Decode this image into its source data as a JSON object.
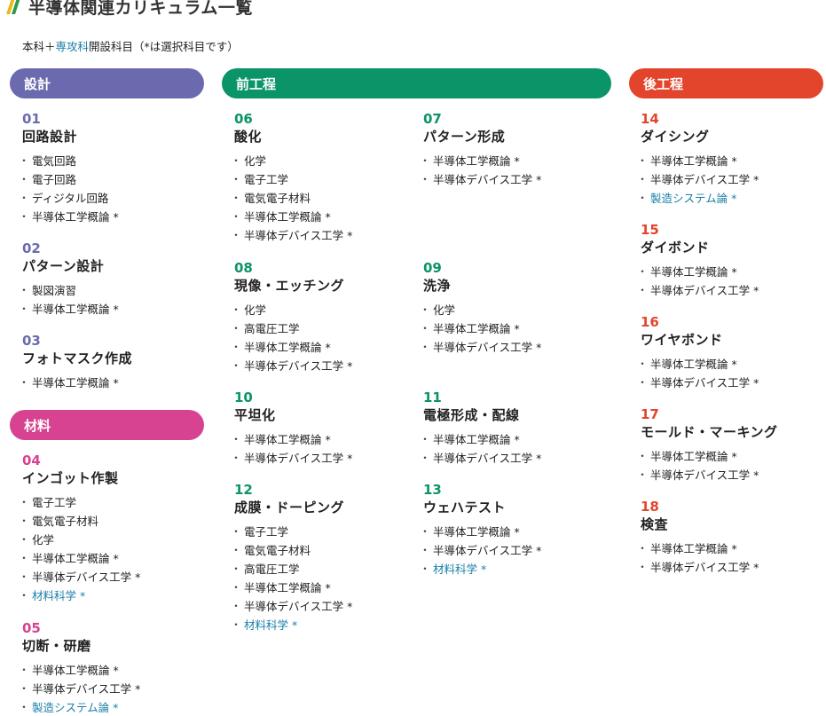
{
  "header": {
    "title": "半導体関連カリキュラム一覧"
  },
  "subtitle": {
    "prefix": "本科＋",
    "highlight": "専攻科",
    "suffix": "開設科目（*は選択科目です）"
  },
  "colors": {
    "design": "#6b6aae",
    "material": "#d74390",
    "front": "#0a9468",
    "back": "#e2452b",
    "link": "#1a7fa8"
  },
  "categories": {
    "design": "設計",
    "material": "材料",
    "front": "前工程",
    "back": "後工程"
  },
  "steps": {
    "s01": {
      "num": "01",
      "name": "回路設計",
      "items": [
        "電気回路",
        "電子回路",
        "ディジタル回路",
        "半導体工学概論 *"
      ]
    },
    "s02": {
      "num": "02",
      "name": "パターン設計",
      "items": [
        "製図演習",
        "半導体工学概論 *"
      ]
    },
    "s03": {
      "num": "03",
      "name": "フォトマスク作成",
      "items": [
        "半導体工学概論 *"
      ]
    },
    "s04": {
      "num": "04",
      "name": "インゴット作製",
      "items": [
        "電子工学",
        "電気電子材料",
        "化学",
        "半導体工学概論 *",
        "半導体デバイス工学 *",
        "材料科学 *"
      ]
    },
    "s05": {
      "num": "05",
      "name": "切断・研磨",
      "items": [
        "半導体工学概論 *",
        "半導体デバイス工学 *",
        "製造システム論 *"
      ]
    },
    "s06": {
      "num": "06",
      "name": "酸化",
      "items": [
        "化学",
        "電子工学",
        "電気電子材料",
        "半導体工学概論 *",
        "半導体デバイス工学 *"
      ]
    },
    "s07": {
      "num": "07",
      "name": "パターン形成",
      "items": [
        "半導体工学概論 *",
        "半導体デバイス工学 *"
      ]
    },
    "s08": {
      "num": "08",
      "name": "現像・エッチング",
      "items": [
        "化学",
        "高電圧工学",
        "半導体工学概論 *",
        "半導体デバイス工学 *"
      ]
    },
    "s09": {
      "num": "09",
      "name": "洗浄",
      "items": [
        "化学",
        "半導体工学概論 *",
        "半導体デバイス工学 *"
      ]
    },
    "s10": {
      "num": "10",
      "name": "平坦化",
      "items": [
        "半導体工学概論 *",
        "半導体デバイス工学 *"
      ]
    },
    "s11": {
      "num": "11",
      "name": "電極形成・配線",
      "items": [
        "半導体工学概論 *",
        "半導体デバイス工学 *"
      ]
    },
    "s12": {
      "num": "12",
      "name": "成膜・ドーピング",
      "items": [
        "電子工学",
        "電気電子材料",
        "高電圧工学",
        "半導体工学概論 *",
        "半導体デバイス工学 *",
        "材料科学 *"
      ]
    },
    "s13": {
      "num": "13",
      "name": "ウェハテスト",
      "items": [
        "半導体工学概論 *",
        "半導体デバイス工学 *",
        "材料科学 *"
      ]
    },
    "s14": {
      "num": "14",
      "name": "ダイシング",
      "items": [
        "半導体工学概論 *",
        "半導体デバイス工学 *",
        "製造システム論 *"
      ]
    },
    "s15": {
      "num": "15",
      "name": "ダイボンド",
      "items": [
        "半導体工学概論 *",
        "半導体デバイス工学 *"
      ]
    },
    "s16": {
      "num": "16",
      "name": "ワイヤボンド",
      "items": [
        "半導体工学概論 *",
        "半導体デバイス工学 *"
      ]
    },
    "s17": {
      "num": "17",
      "name": "モールド・マーキング",
      "items": [
        "半導体工学概論 *",
        "半導体デバイス工学 *"
      ]
    },
    "s18": {
      "num": "18",
      "name": "検査",
      "items": [
        "半導体工学概論 *",
        "半導体デバイス工学 *"
      ]
    }
  }
}
